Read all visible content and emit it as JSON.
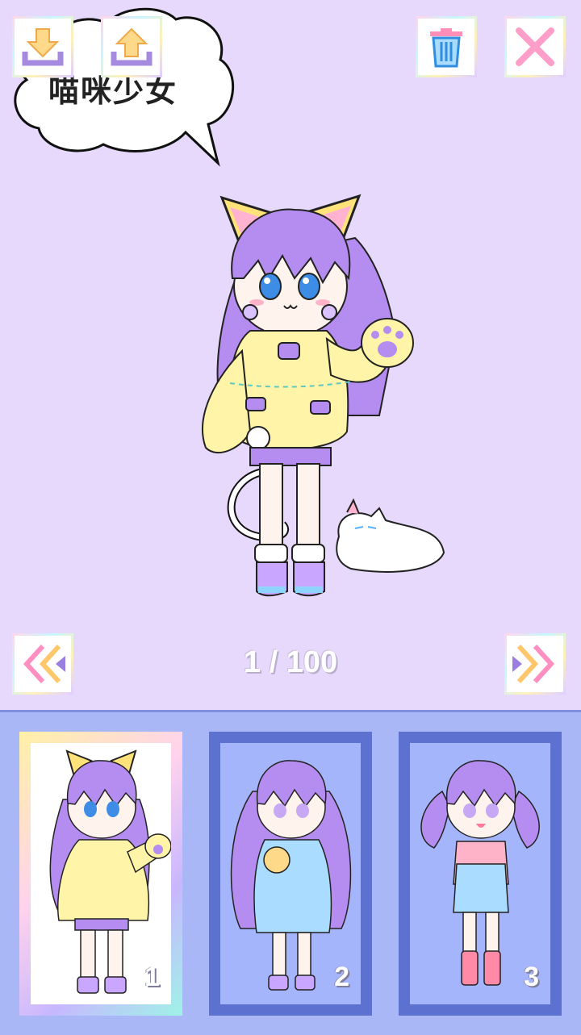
{
  "header": {
    "bubble_title": "喵咪少女"
  },
  "toolbar": {
    "download_icon": "download-icon",
    "upload_icon": "upload-icon",
    "trash_icon": "trash-icon",
    "close_icon": "close-icon"
  },
  "navigation": {
    "counter": "1 / 100",
    "prev_icon": "double-chevron-left-icon",
    "next_icon": "double-chevron-right-icon"
  },
  "slots": [
    {
      "number": "1",
      "selected": true
    },
    {
      "number": "2",
      "selected": false
    },
    {
      "number": "3",
      "selected": false
    }
  ],
  "colors": {
    "background": "#e6d9fb",
    "tray": "#aab7f7",
    "slot_frame": "#5d72d0",
    "hair": "#b58cf0",
    "hoodie": "#fff4a8",
    "accent_pink": "#ff9ec8"
  }
}
